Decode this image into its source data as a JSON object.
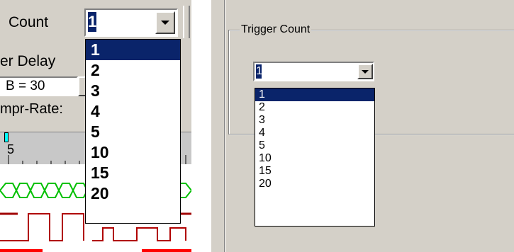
{
  "left": {
    "count_label": "Count",
    "count_value": "1",
    "trigger_delay_label": "er Delay",
    "b_field_value": "B = 30",
    "sample_rate_label": "mpr-Rate:",
    "ruler_label": "5",
    "options": [
      "1",
      "2",
      "3",
      "4",
      "5",
      "10",
      "15",
      "20"
    ],
    "selected_index": 0,
    "colors": {
      "highlight": "#0a246a",
      "waveform_green": "#00c000",
      "waveform_red": "#a00000",
      "marker_cyan": "#00ffff"
    }
  },
  "right": {
    "group_title": "Trigger Count",
    "count_value": "1",
    "options": [
      "1",
      "2",
      "3",
      "4",
      "5",
      "10",
      "15",
      "20"
    ],
    "selected_index": 0
  }
}
